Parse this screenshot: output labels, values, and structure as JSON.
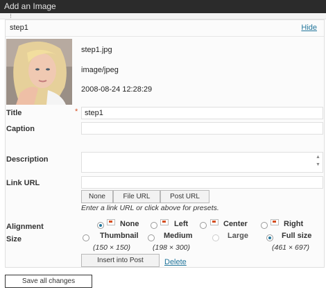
{
  "window": {
    "title": "Add an Image"
  },
  "item": {
    "filename": "step1",
    "hide_label": "Hide"
  },
  "meta": {
    "file_name": "step1.jpg",
    "mime": "image/jpeg",
    "date": "2008-08-24 12:28:29"
  },
  "fields": {
    "title_label": "Title",
    "title_required": "*",
    "title_value": "step1",
    "caption_label": "Caption",
    "caption_value": "",
    "description_label": "Description",
    "description_value": "",
    "link_url_label": "Link URL",
    "link_url_value": "",
    "link_buttons": [
      "None",
      "File URL",
      "Post URL"
    ],
    "link_help": "Enter a link URL or click above for presets."
  },
  "alignment": {
    "label": "Alignment",
    "options": [
      "None",
      "Left",
      "Center",
      "Right"
    ],
    "selected": "None"
  },
  "size": {
    "label": "Size",
    "options": [
      {
        "name": "Thumbnail",
        "dims": "(150 × 150)"
      },
      {
        "name": "Medium",
        "dims": "(198 × 300)"
      },
      {
        "name": "Large",
        "dims": ""
      },
      {
        "name": "Full size",
        "dims": "(461 × 697)"
      }
    ],
    "selected": "Full size"
  },
  "actions": {
    "insert": "Insert into Post",
    "delete": "Delete",
    "save_all": "Save all changes"
  },
  "colors": {
    "link": "#21759b",
    "required": "#d54e21",
    "titlebar": "#2b2b2b"
  },
  "icons": {
    "alignment": "align-icon",
    "thumb": "photo-thumbnail"
  }
}
